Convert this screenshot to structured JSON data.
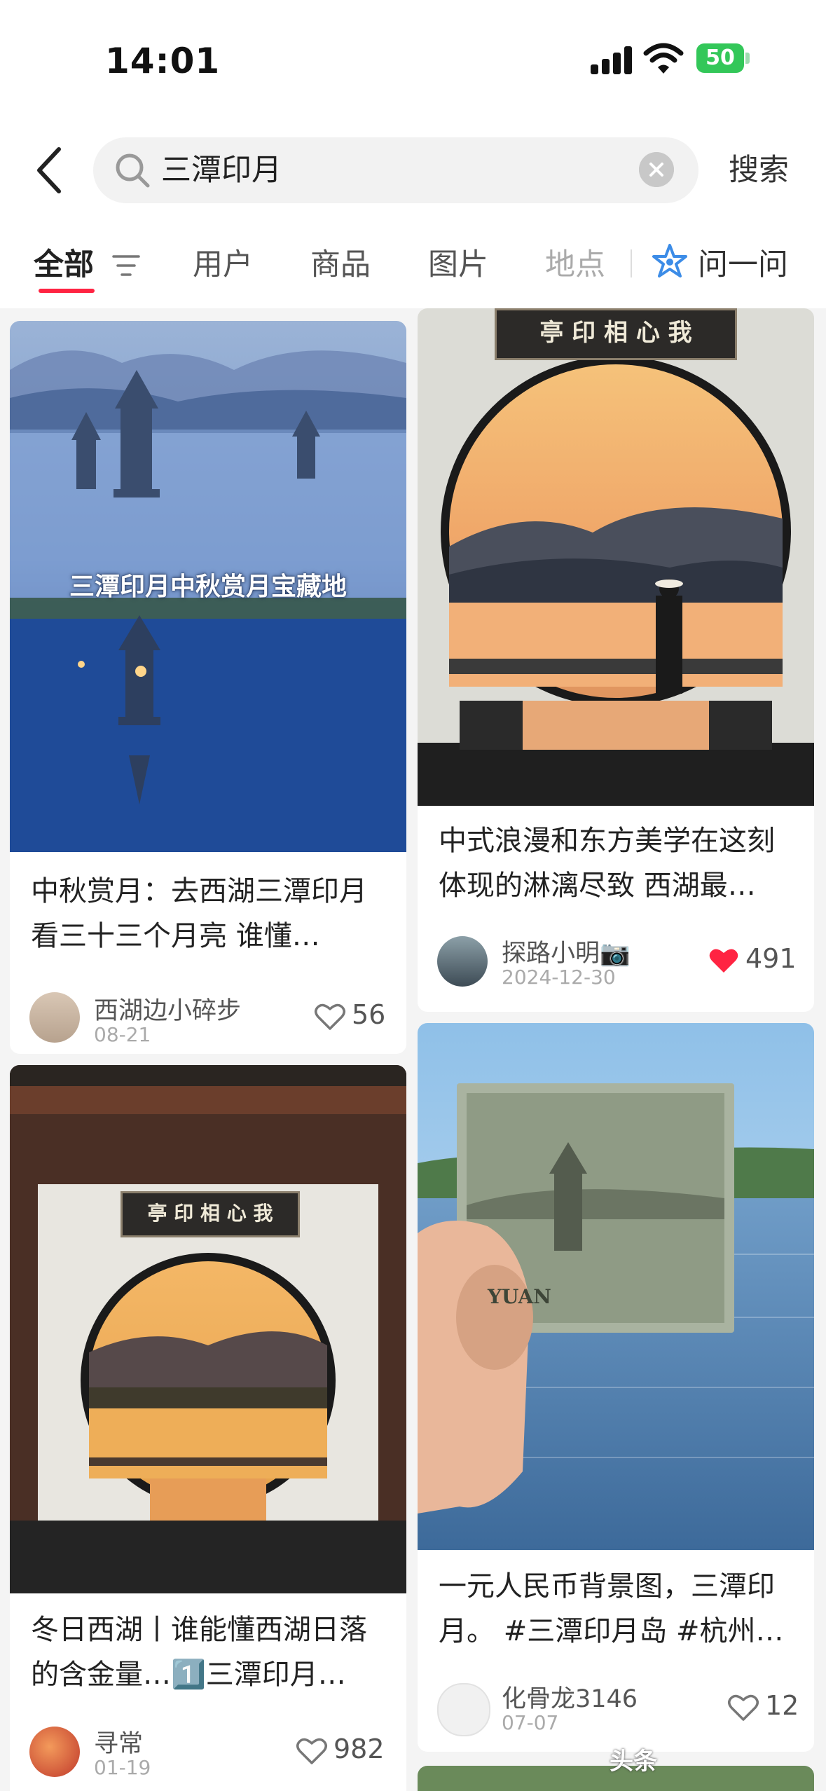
{
  "status_bar": {
    "time": "14:01",
    "battery": "50"
  },
  "search": {
    "query": "三潭印月",
    "search_label": "搜索"
  },
  "tabs": [
    {
      "label": "全部"
    },
    {
      "label": "用户"
    },
    {
      "label": "商品"
    },
    {
      "label": "图片"
    },
    {
      "label": "地点"
    },
    {
      "label": "问一问"
    }
  ],
  "feed": {
    "card1": {
      "overlay": "三潭印月中秋赏月宝藏地",
      "title": "中秋赏月：去西湖三潭印月看三十三个月亮 谁懂…",
      "author": "西湖边小碎步",
      "date": "08-21",
      "likes": "56"
    },
    "card2": {
      "plaque": "亭 印 相 心 我",
      "title": "中式浪漫和东方美学在这刻体现的淋漓尽致 西湖最…",
      "author": "探路小明📷",
      "date": "2024-12-30",
      "likes": "491"
    },
    "card3": {
      "plaque": "亭 印 相 心 我",
      "title": "冬日西湖丨谁能懂西湖日落的含金量…1️⃣三潭印月…",
      "author": "寻常",
      "date": "01-19",
      "likes": "982"
    },
    "card4": {
      "banknote_text": "YUAN",
      "title": "一元人民币背景图，三潭印月。 #三潭印月岛 #杭州…",
      "author": "化骨龙3146",
      "date": "07-07",
      "likes": "12"
    }
  },
  "watermark": "头条"
}
